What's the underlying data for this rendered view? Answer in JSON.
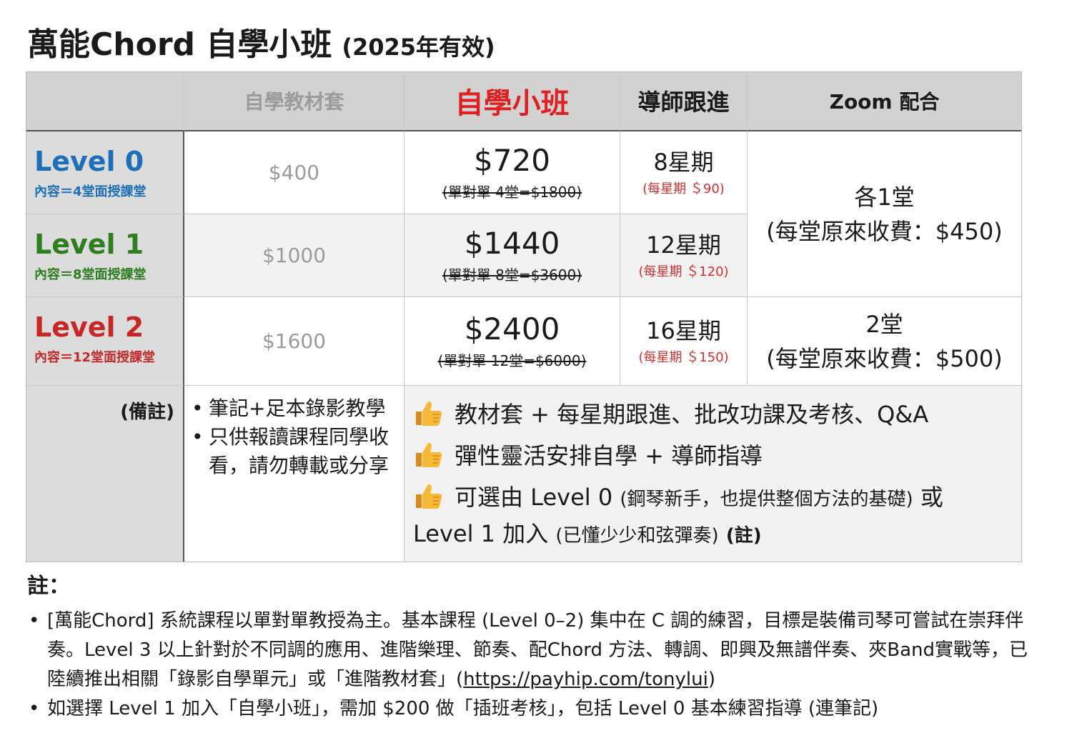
{
  "title": {
    "main": "萬能Chord 自學小班",
    "sub": "(2025年有效)"
  },
  "header": {
    "blank": "",
    "kit": "自學教材套",
    "class": "自學小班",
    "tutor": "導師跟進",
    "zoom": "Zoom 配合"
  },
  "colors": {
    "level0": "#1d6fb8",
    "level1": "#2e7d1f",
    "level2": "#c62828",
    "accent_red": "#e02020"
  },
  "rows": [
    {
      "name": "Level 0",
      "desc": "內容＝4堂面授課堂",
      "kit": "$400",
      "price": "$720",
      "orig": "(單對單 4堂=$1800)",
      "weeks": "8星期",
      "weekly": "(每星期 ＄90)"
    },
    {
      "name": "Level 1",
      "desc": "內容＝8堂面授課堂",
      "kit": "$1000",
      "price": "$1440",
      "orig": "(單對單 8堂=$3600)",
      "weeks": "12星期",
      "weekly": "(每星期 ＄120)"
    },
    {
      "name": "Level 2",
      "desc": "內容＝12堂面授課堂",
      "kit": "$1600",
      "price": "$2400",
      "orig": "(單對單 12堂=$6000)",
      "weeks": "16星期",
      "weekly": "(每星期 ＄150)"
    }
  ],
  "zoom": {
    "a_line1": "各1堂",
    "a_line2": "(每堂原來收費：$450)",
    "b_line1": "2堂",
    "b_line2": "(每堂原來收費：$500)"
  },
  "remarks": {
    "label": "(備註)",
    "kit_notes": [
      "筆記+足本錄影教學",
      "只供報讀課程同學收看，請勿轉載或分享"
    ],
    "benefit1": "教材套 + 每星期跟進、批改功課及考核、Q&A",
    "benefit2": "彈性靈活安排自學 + 導師指導",
    "benefit3_a": "可選由 Level 0",
    "benefit3_b": "(鋼琴新手，也提供整個方法的基礎)",
    "benefit3_c": "或",
    "benefit3_d": "Level 1 加入",
    "benefit3_e": "(已懂少少和弦彈奏)",
    "benefit3_f": "(註)"
  },
  "footer": {
    "head": "註：",
    "note1_text": "[萬能Chord] 系統課程以單對單教授為主。基本課程 (Level 0–2) 集中在 C 調的練習，目標是裝備司琴可嘗試在崇拜伴奏。Level 3 以上針對於不同調的應用、進階樂理、節奏、配Chord 方法、轉調、即興及無譜伴奏、夾Band實戰等，已陸續推出相關「錄影自學單元」或「進階教材套」(",
    "note1_link": "https://payhip.com/tonylui",
    "note1_end": ")",
    "note2": "如選擇 Level 1 加入「自學小班」，需加 $200 做「插班考核」，包括 Level 0 基本練習指導 (連筆記)"
  }
}
